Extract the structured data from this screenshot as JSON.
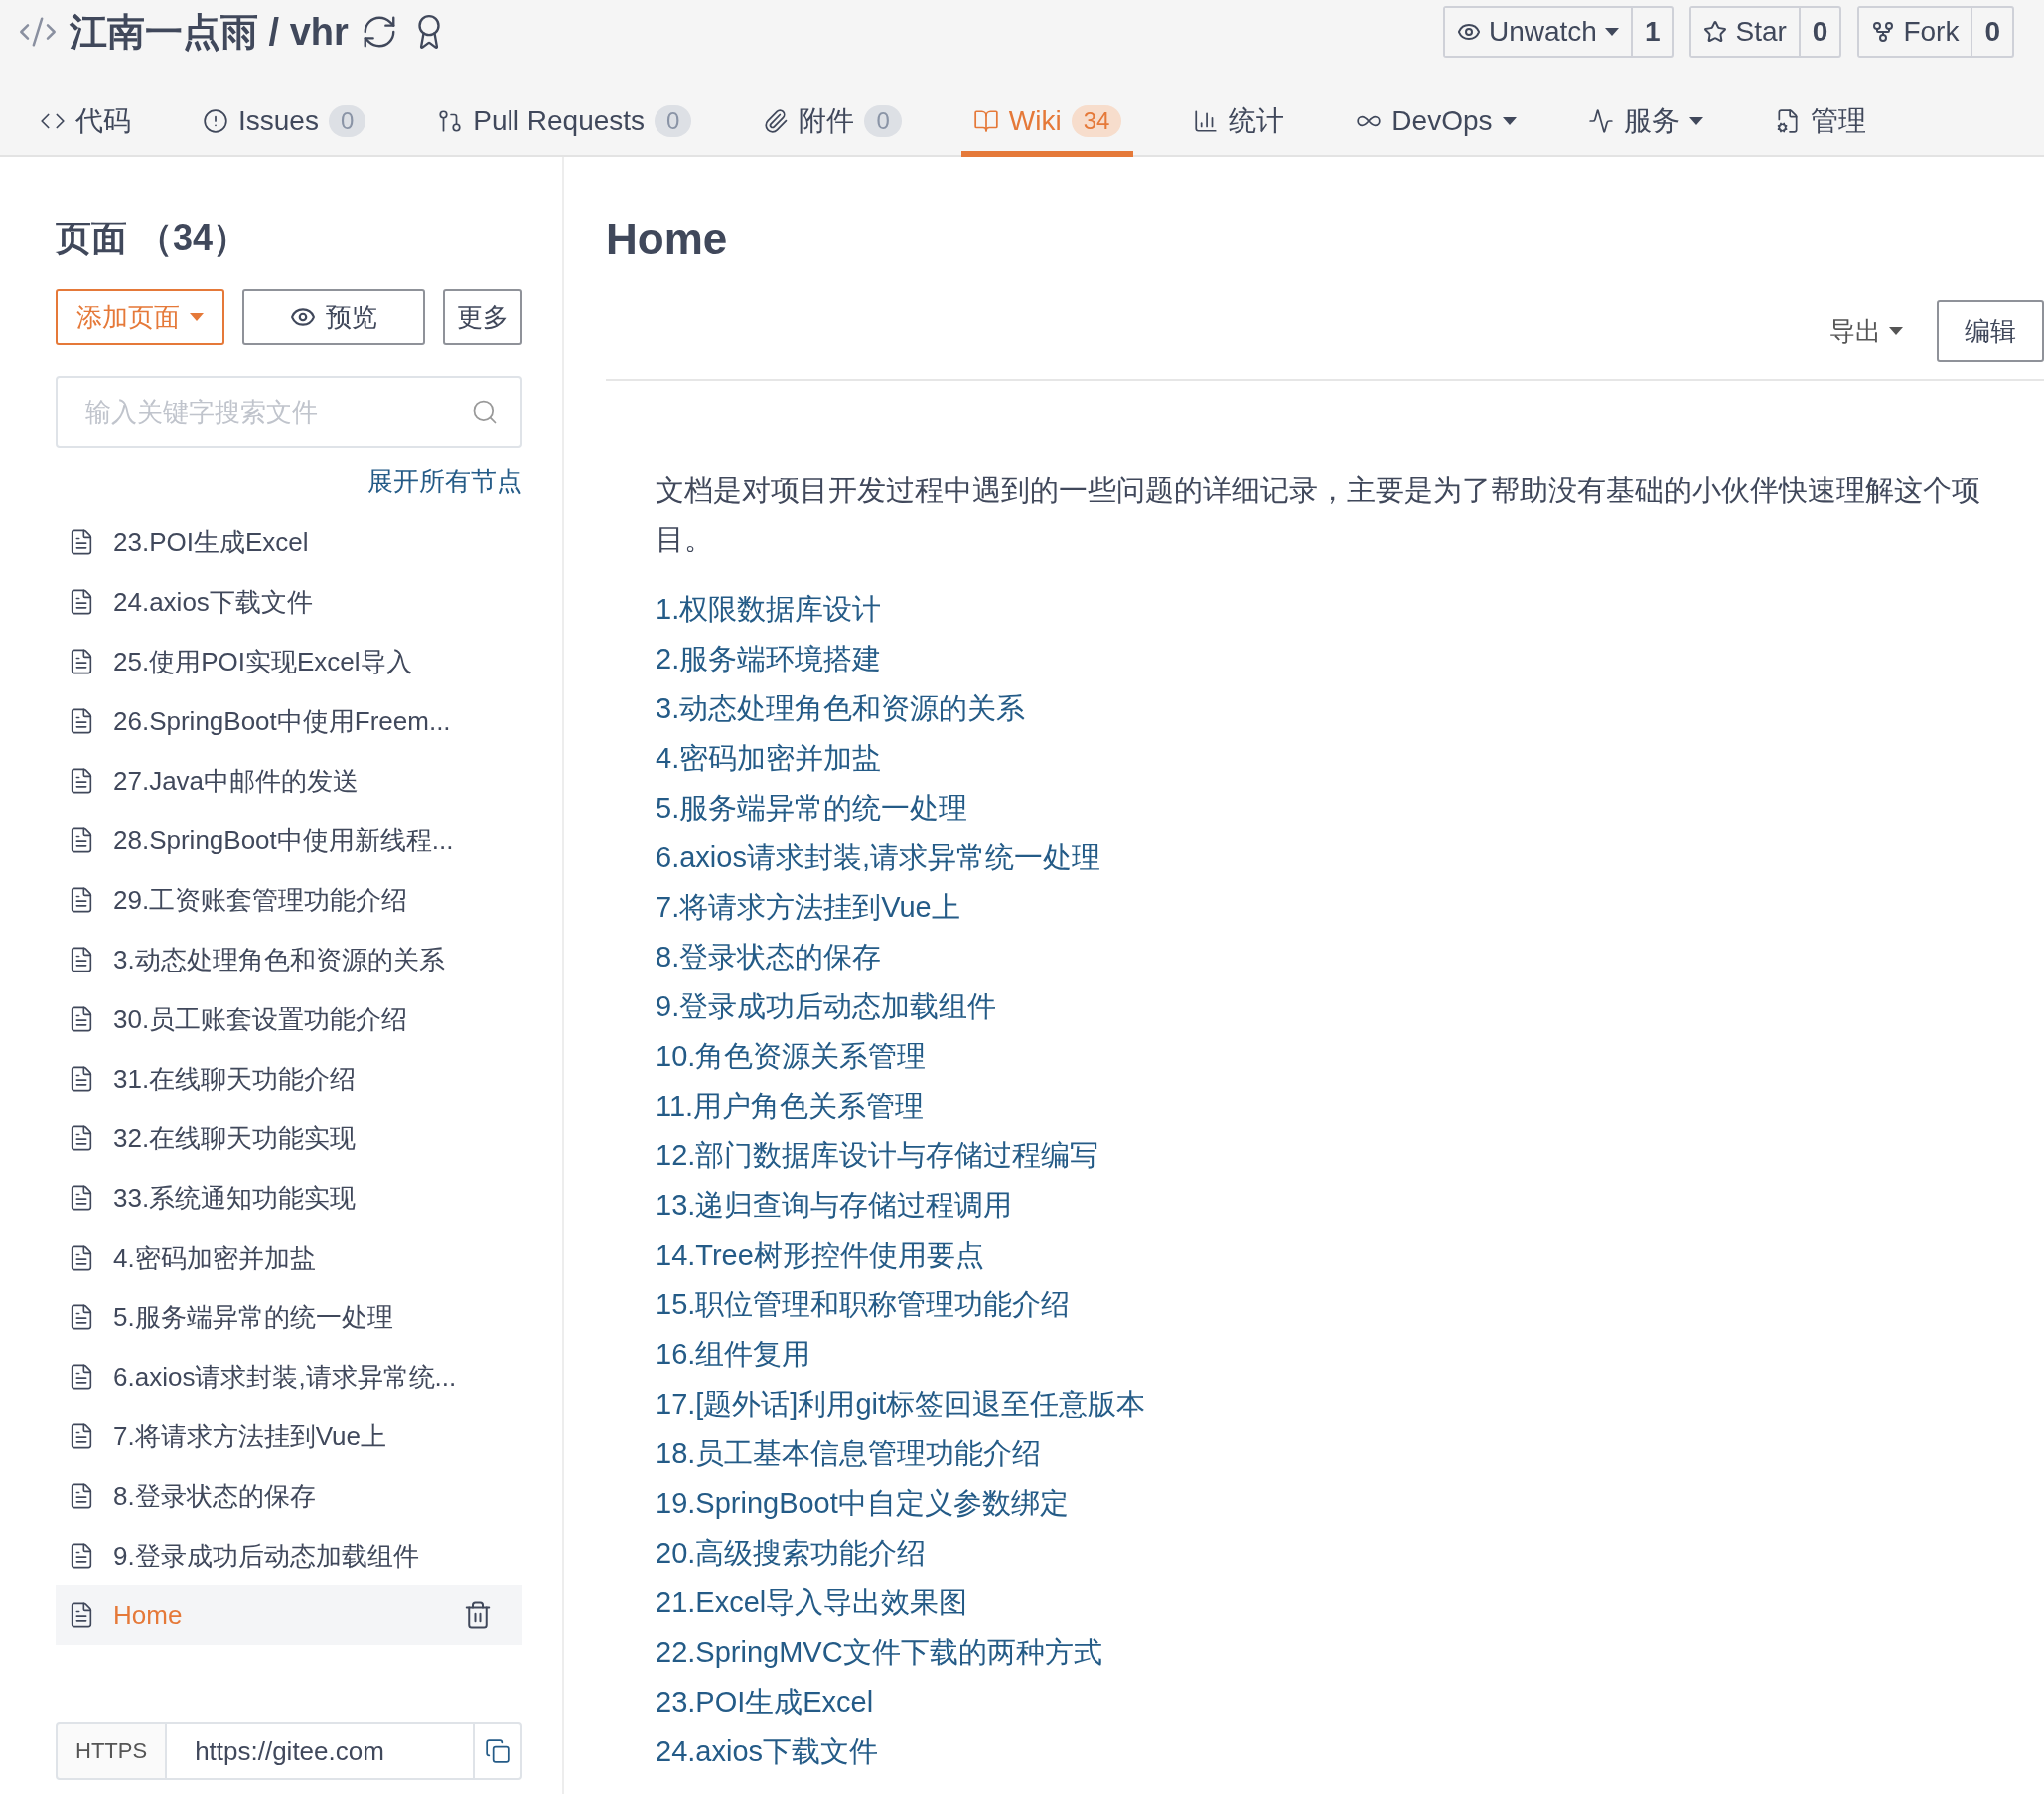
{
  "repo": {
    "owner": "江南一点雨",
    "separator": "/",
    "name": "vhr"
  },
  "repo_actions": [
    {
      "label": "Unwatch",
      "dropdown": true,
      "count": "1"
    },
    {
      "label": "Star",
      "dropdown": false,
      "count": "0"
    },
    {
      "label": "Fork",
      "dropdown": false,
      "count": "0"
    }
  ],
  "tabs": [
    {
      "label": "代码",
      "selected": false,
      "dropdown": false
    },
    {
      "label": "Issues",
      "count": "0",
      "selected": false,
      "dropdown": false
    },
    {
      "label": "Pull Requests",
      "count": "0",
      "selected": false,
      "dropdown": false
    },
    {
      "label": "附件",
      "count": "0",
      "selected": false,
      "dropdown": false
    },
    {
      "label": "Wiki",
      "count": "34",
      "selected": true,
      "dropdown": false
    },
    {
      "label": "统计",
      "selected": false,
      "dropdown": false
    },
    {
      "label": "DevOps",
      "selected": false,
      "dropdown": true
    },
    {
      "label": "服务",
      "selected": false,
      "dropdown": true
    },
    {
      "label": "管理",
      "selected": false,
      "dropdown": false
    }
  ],
  "sidebar": {
    "title": "页面 （34）",
    "buttons": [
      {
        "label": "添加页面",
        "kind": "primary"
      },
      {
        "label": "预览",
        "kind": "preview"
      },
      {
        "label": "更多",
        "kind": "plain"
      }
    ],
    "search": {
      "placeholder": "输入关键字搜索文件"
    },
    "expand_link": "展开所有节点",
    "pages": [
      {
        "label": "23.POI生成Excel",
        "selected": false
      },
      {
        "label": "24.axios下载文件",
        "selected": false
      },
      {
        "label": "25.使用POI实现Excel导入",
        "selected": false
      },
      {
        "label": "26.SpringBoot中使用Freem...",
        "selected": false
      },
      {
        "label": "27.Java中邮件的发送",
        "selected": false
      },
      {
        "label": "28.SpringBoot中使用新线程...",
        "selected": false
      },
      {
        "label": "29.工资账套管理功能介绍",
        "selected": false
      },
      {
        "label": "3.动态处理角色和资源的关系",
        "selected": false
      },
      {
        "label": "30.员工账套设置功能介绍",
        "selected": false
      },
      {
        "label": "31.在线聊天功能介绍",
        "selected": false
      },
      {
        "label": "32.在线聊天功能实现",
        "selected": false
      },
      {
        "label": "33.系统通知功能实现",
        "selected": false
      },
      {
        "label": "4.密码加密并加盐",
        "selected": false
      },
      {
        "label": "5.服务端异常的统一处理",
        "selected": false
      },
      {
        "label": "6.axios请求封装,请求异常统...",
        "selected": false
      },
      {
        "label": "7.将请求方法挂到Vue上",
        "selected": false
      },
      {
        "label": "8.登录状态的保存",
        "selected": false
      },
      {
        "label": "9.登录成功后动态加载组件",
        "selected": false
      },
      {
        "label": "Home",
        "selected": true
      }
    ],
    "clone": {
      "protocol": "HTTPS",
      "url": "https://gitee.com"
    }
  },
  "content": {
    "title": "Home",
    "export": "导出",
    "edit": "编辑",
    "intro": "文档是对项目开发过程中遇到的一些问题的详细记录，主要是为了帮助没有基础的小伙伴快速理解这个项目。",
    "links": [
      "1.权限数据库设计",
      "2.服务端环境搭建",
      "3.动态处理角色和资源的关系",
      "4.密码加密并加盐",
      "5.服务端异常的统一处理",
      "6.axios请求封装,请求异常统一处理",
      "7.将请求方法挂到Vue上",
      "8.登录状态的保存",
      "9.登录成功后动态加载组件",
      "10.角色资源关系管理",
      "11.用户角色关系管理",
      "12.部门数据库设计与存储过程编写",
      "13.递归查询与存储过程调用",
      "14.Tree树形控件使用要点",
      "15.职位管理和职称管理功能介绍",
      "16.组件复用",
      "17.[题外话]利用git标签回退至任意版本",
      "18.员工基本信息管理功能介绍",
      "19.SpringBoot中自定义参数绑定",
      "20.高级搜索功能介绍",
      "21.Excel导入导出效果图",
      "22.SpringMVC文件下载的两种方式",
      "23.POI生成Excel",
      "24.axios下载文件"
    ]
  }
}
